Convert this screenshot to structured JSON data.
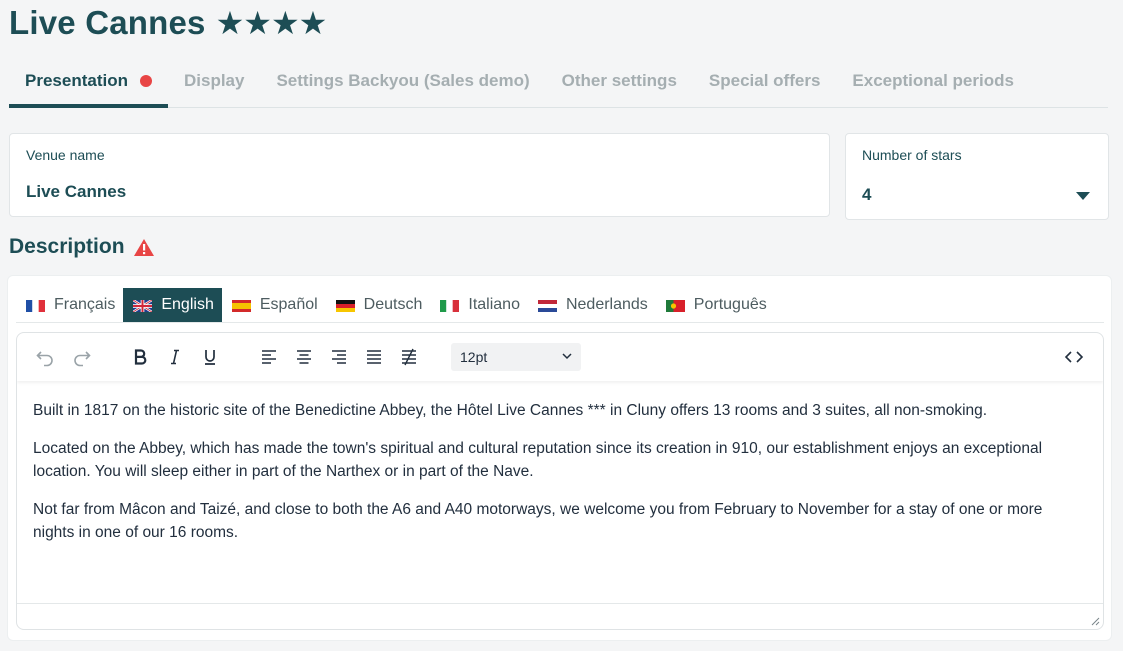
{
  "page": {
    "title": "Live Cannes",
    "stars": "★★★★"
  },
  "tabs": [
    {
      "label": "Presentation",
      "active": true,
      "has_alert": true
    },
    {
      "label": "Display"
    },
    {
      "label": "Settings Backyou (Sales demo)"
    },
    {
      "label": "Other settings"
    },
    {
      "label": "Special offers"
    },
    {
      "label": "Exceptional periods"
    }
  ],
  "venue": {
    "label": "Venue name",
    "value": "Live Cannes"
  },
  "stars_field": {
    "label": "Number of stars",
    "value": "4"
  },
  "description": {
    "title": "Description",
    "alert_icon": "warning-triangle-icon"
  },
  "languages": [
    {
      "label": "Français",
      "flag": "fr"
    },
    {
      "label": "English",
      "flag": "gb",
      "active": true
    },
    {
      "label": "Español",
      "flag": "es"
    },
    {
      "label": "Deutsch",
      "flag": "de"
    },
    {
      "label": "Italiano",
      "flag": "it"
    },
    {
      "label": "Nederlands",
      "flag": "nl"
    },
    {
      "label": "Português",
      "flag": "pt"
    }
  ],
  "toolbar": {
    "font_size": "12pt"
  },
  "content": {
    "paragraphs": [
      "Built in 1817 on the historic site of the Benedictine Abbey, the Hôtel Live Cannes *** in Cluny offers 13 rooms and 3 suites, all non-smoking.",
      "Located on the Abbey, which has made the town's spiritual and cultural reputation since its creation in 910, our establishment enjoys an exceptional location. You will sleep either in part of the Narthex or in part of the Nave.",
      "Not far from Mâcon and Taizé, and close to both the A6 and A40 motorways, we welcome you from February to November for a stay of one or more nights in one of our 16 rooms."
    ]
  },
  "colors": {
    "primary": "#1d4d55",
    "alert": "#e84545",
    "inactive_tab": "#a5aeb1"
  }
}
